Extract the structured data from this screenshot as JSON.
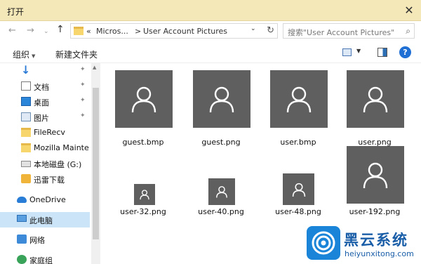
{
  "window": {
    "title": "打开",
    "close_glyph": "✕"
  },
  "address": {
    "nav_back": "←",
    "nav_forward": "→",
    "nav_dropdown": "⌄",
    "nav_up": "↑",
    "crumbs": [
      "«",
      "Micros...",
      ">",
      "User Account Pictures",
      "⌄"
    ],
    "refresh_glyph": "↻",
    "search_placeholder": "搜索\"User Account Pictures\"",
    "search_glyph": "⌕"
  },
  "toolbar": {
    "organize": "组织",
    "organize_arrow": "▼",
    "new_folder": "新建文件夹",
    "view_arrow": "▼",
    "help": "?"
  },
  "nav": {
    "pin_glyph": "✦",
    "items": [
      {
        "label": "文档"
      },
      {
        "label": "桌面"
      },
      {
        "label": "图片"
      },
      {
        "label": "FileRecv"
      },
      {
        "label": "Mozilla Mainte"
      },
      {
        "label": "本地磁盘 (G:)"
      },
      {
        "label": "迅雷下载"
      },
      {
        "label": "OneDrive"
      },
      {
        "label": "此电脑"
      },
      {
        "label": "网络"
      },
      {
        "label": "家庭组"
      }
    ]
  },
  "scrollbar": {
    "up_glyph": "▲"
  },
  "files": [
    {
      "name": "guest.bmp"
    },
    {
      "name": "guest.png"
    },
    {
      "name": "user.bmp"
    },
    {
      "name": "user.png"
    },
    {
      "name": "user-32.png"
    },
    {
      "name": "user-40.png"
    },
    {
      "name": "user-48.png"
    },
    {
      "name": "user-192.png"
    }
  ],
  "watermark": {
    "cn": "黑云系统",
    "en": "heiyunxitong.com"
  },
  "colors": {
    "titlebar": "#f5e8b8",
    "selection": "#cce4f7",
    "thumbnail": "#5f5f5f",
    "accent": "#1f6fd4"
  }
}
